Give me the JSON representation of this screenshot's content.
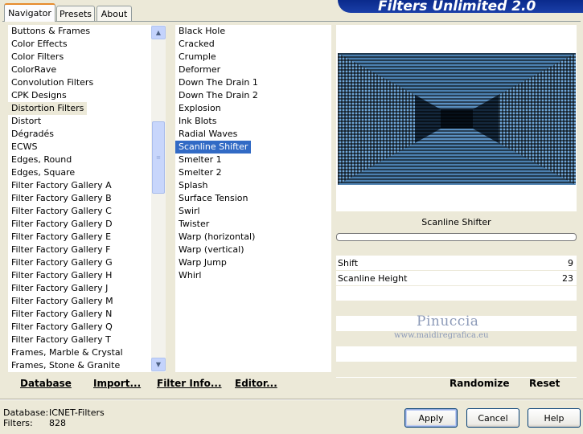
{
  "app_title": "Filters Unlimited 2.0",
  "tabs": [
    {
      "label": "Navigator",
      "active": true
    },
    {
      "label": "Presets",
      "active": false
    },
    {
      "label": "About",
      "active": false
    }
  ],
  "categories": [
    "Buttons & Frames",
    "Color Effects",
    "Color Filters",
    "ColorRave",
    "Convolution Filters",
    "CPK Designs",
    "Distortion Filters",
    "Distort",
    "Dégradés",
    "ECWS",
    "Edges, Round",
    "Edges, Square",
    "Filter Factory Gallery A",
    "Filter Factory Gallery B",
    "Filter Factory Gallery C",
    "Filter Factory Gallery D",
    "Filter Factory Gallery E",
    "Filter Factory Gallery F",
    "Filter Factory Gallery G",
    "Filter Factory Gallery H",
    "Filter Factory Gallery J",
    "Filter Factory Gallery M",
    "Filter Factory Gallery N",
    "Filter Factory Gallery Q",
    "Filter Factory Gallery T",
    "Frames, Marble & Crystal",
    "Frames, Stone & Granite"
  ],
  "selected_category_index": 6,
  "filters": [
    "Black Hole",
    "Cracked",
    "Crumple",
    "Deformer",
    "Down The Drain 1",
    "Down The Drain 2",
    "Explosion",
    "Ink Blots",
    "Radial Waves",
    "Scanline Shifter",
    "Smelter 1",
    "Smelter 2",
    "Splash",
    "Surface Tension",
    "Swirl",
    "Twister",
    "Warp (horizontal)",
    "Warp (vertical)",
    "Warp Jump",
    "Whirl"
  ],
  "selected_filter_index": 9,
  "left_buttons": {
    "database": "Database",
    "import": "Import...",
    "filter_info": "Filter Info...",
    "editor": "Editor..."
  },
  "right_buttons": {
    "randomize": "Randomize",
    "reset": "Reset"
  },
  "preview": {
    "filter_name": "Scanline Shifter",
    "progress": 0
  },
  "params": [
    {
      "label": "Shift",
      "value": "9"
    },
    {
      "label": "Scanline Height",
      "value": "23"
    }
  ],
  "watermark": {
    "name": "Pinuccia",
    "url": "www.maidiregrafica.eu"
  },
  "status": {
    "database_label": "Database:",
    "database_value": "ICNET-Filters",
    "filters_label": "Filters:",
    "filters_value": "828"
  },
  "dialog_buttons": {
    "apply": "Apply",
    "cancel": "Cancel",
    "help": "Help"
  },
  "colors": {
    "selection_blue": "#316AC5",
    "banner_blue": "#0A2A8C",
    "preview_cyan": "#6FA6D8"
  }
}
